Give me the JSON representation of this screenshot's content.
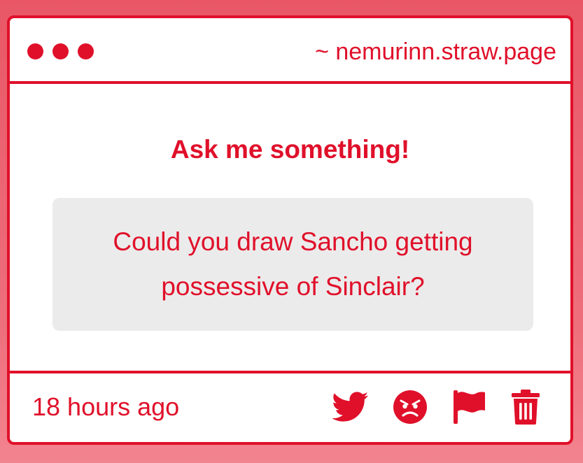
{
  "window": {
    "url": "~ nemurinn.straw.page"
  },
  "main": {
    "heading": "Ask me something!",
    "question": "Could you draw Sancho getting possessive of Sinclair?"
  },
  "footer": {
    "timestamp": "18 hours ago",
    "actions": [
      {
        "icon": "twitter-bird-icon"
      },
      {
        "icon": "angry-face-icon"
      },
      {
        "icon": "flag-icon"
      },
      {
        "icon": "trash-icon"
      }
    ]
  },
  "colors": {
    "accent": "#e0102a",
    "background": "#e95766",
    "question_bg": "#ecebeb"
  }
}
